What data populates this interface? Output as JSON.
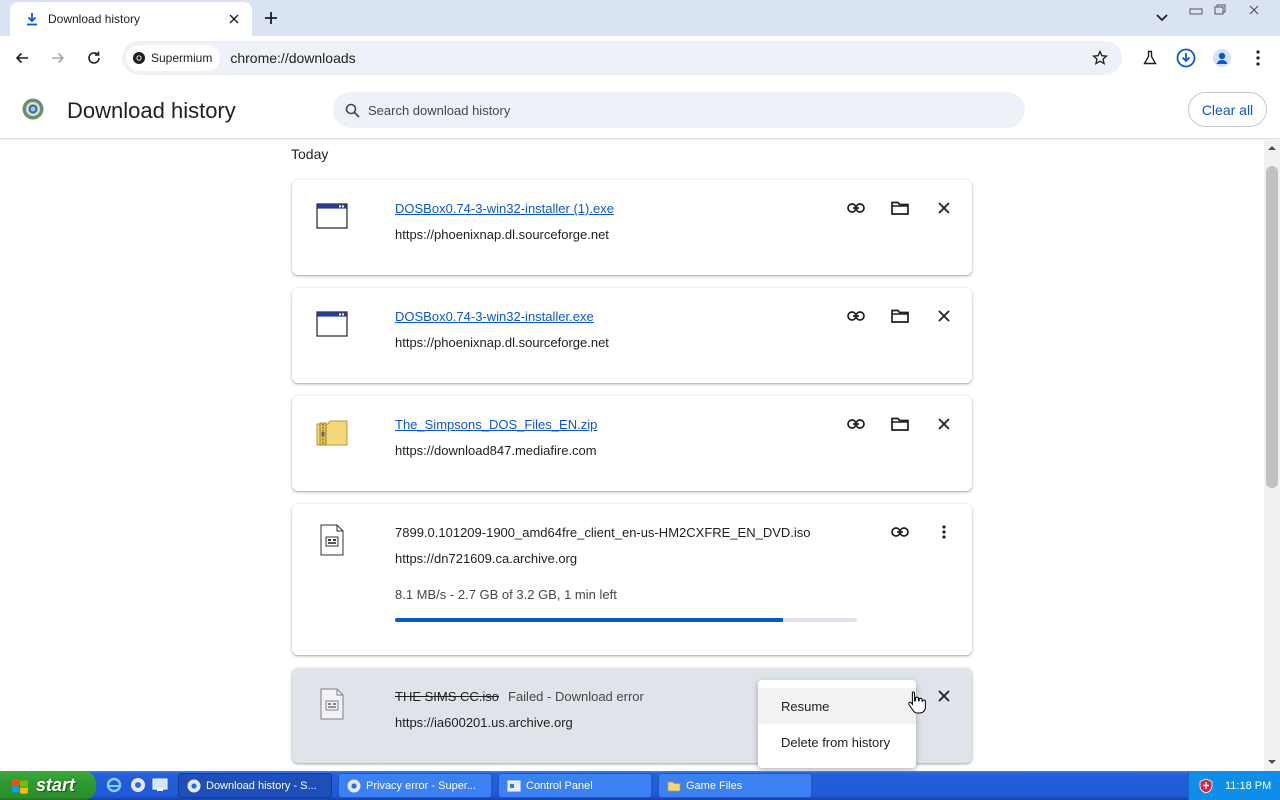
{
  "browser": {
    "tab": {
      "title": "Download history"
    },
    "omnibox": {
      "chip_label": "Supermium",
      "url": "chrome://downloads"
    }
  },
  "page": {
    "title": "Download history",
    "search_placeholder": "Search download history",
    "clear_all_label": "Clear all",
    "date_group": "Today"
  },
  "downloads": [
    {
      "name": "DOSBox0.74-3-win32-installer (1).exe",
      "source": "https://phoenixnap.dl.sourceforge.net",
      "icon": "window-app-icon",
      "state": "complete"
    },
    {
      "name": "DOSBox0.74-3-win32-installer.exe",
      "source": "https://phoenixnap.dl.sourceforge.net",
      "icon": "window-app-icon",
      "state": "complete"
    },
    {
      "name": "The_Simpsons_DOS_Files_EN.zip",
      "source": "https://download847.mediafire.com",
      "icon": "zip-folder-icon",
      "state": "complete"
    },
    {
      "name": "7899.0.101209-1900_amd64fre_client_en-us-HM2CXFRE_EN_DVD.iso",
      "source": "https://dn721609.ca.archive.org",
      "icon": "disc-image-icon",
      "state": "in_progress",
      "progress_text": "8.1 MB/s - 2.7 GB of 3.2 GB, 1 min left",
      "progress": 0.84
    },
    {
      "name": "THE SIMS CC.iso",
      "source": "https://ia600201.us.archive.org",
      "icon": "disc-image-icon",
      "state": "failed",
      "status": "Failed - Download error"
    }
  ],
  "context_menu": {
    "items": [
      "Resume",
      "Delete from history"
    ]
  },
  "taskbar": {
    "start_label": "start",
    "tasks": [
      {
        "label": "Download history - S...",
        "icon": "chrome-icon",
        "active": true
      },
      {
        "label": "Privacy error - Super...",
        "icon": "chrome-icon",
        "active": false
      },
      {
        "label": "Control Panel",
        "icon": "control-panel-icon",
        "active": false
      },
      {
        "label": "Game Files",
        "icon": "folder-icon",
        "active": false
      }
    ],
    "clock": "11:18 PM"
  },
  "colors": {
    "accent": "#0b57d0",
    "failed_card": "#dfe3ea",
    "taskbar": "#245edb"
  }
}
